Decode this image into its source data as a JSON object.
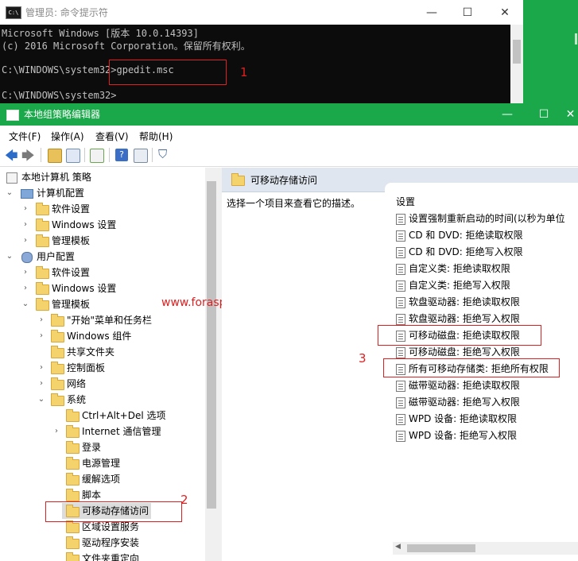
{
  "cmd": {
    "title": "管理员: 命令提示符",
    "icon": "cmd-icon",
    "lines": [
      "Microsoft Windows [版本 10.0.14393]",
      "(c) 2016 Microsoft Corporation。保留所有权利。",
      "",
      "C:\\WINDOWS\\system32>gpedit.msc",
      "",
      "C:\\WINDOWS\\system32>"
    ]
  },
  "annotations": {
    "n1": "1",
    "n2": "2",
    "n3": "3",
    "watermark": "www.forasp.cn",
    "color": "#e02020"
  },
  "gpedit": {
    "title": "本地组策略编辑器",
    "menu": [
      "文件(F)",
      "操作(A)",
      "查看(V)",
      "帮助(H)"
    ],
    "tree": {
      "root": "本地计算机 策略",
      "computer_config": "计算机配置",
      "cc_software": "软件设置",
      "cc_windows": "Windows 设置",
      "cc_admin": "管理模板",
      "user_config": "用户配置",
      "uc_software": "软件设置",
      "uc_windows": "Windows 设置",
      "uc_admin": "管理模板",
      "start_menu": "\"开始\"菜单和任务栏",
      "windows_components": "Windows 组件",
      "shared_folders": "共享文件夹",
      "control_panel": "控制面板",
      "network": "网络",
      "system": "系统",
      "ctrl_alt_del": "Ctrl+Alt+Del 选项",
      "internet_comm": "Internet 通信管理",
      "logon": "登录",
      "power": "电源管理",
      "mitigation": "缓解选项",
      "scripts": "脚本",
      "removable_storage": "可移动存储访问",
      "locale": "区域设置服务",
      "driver_install": "驱动程序安装",
      "folder_redirect": "文件夹重定向"
    },
    "right": {
      "header": "可移动存储访问",
      "description": "选择一个项目来查看它的描述。",
      "column": "设置",
      "policies": [
        "设置强制重新启动的时间(以秒为单位",
        "CD 和 DVD: 拒绝读取权限",
        "CD 和 DVD: 拒绝写入权限",
        "自定义类: 拒绝读取权限",
        "自定义类: 拒绝写入权限",
        "软盘驱动器: 拒绝读取权限",
        "软盘驱动器: 拒绝写入权限",
        "可移动磁盘: 拒绝读取权限",
        "可移动磁盘: 拒绝写入权限",
        "所有可移动存储类: 拒绝所有权限",
        "磁带驱动器: 拒绝读取权限",
        "磁带驱动器: 拒绝写入权限",
        "WPD 设备: 拒绝读取权限",
        "WPD 设备: 拒绝写入权限"
      ]
    }
  }
}
